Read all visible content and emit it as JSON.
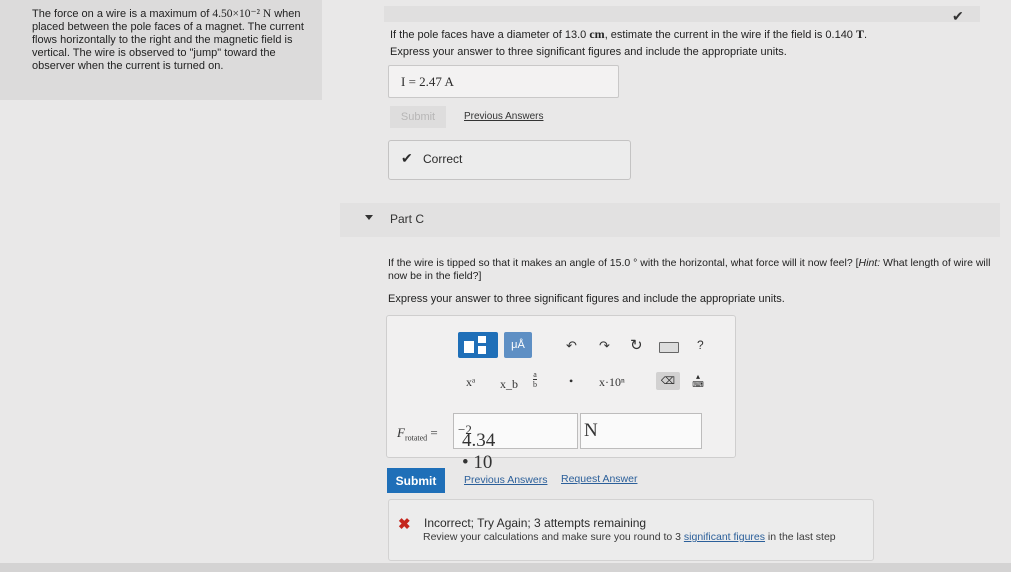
{
  "problem": {
    "line1_pre": "The force on a wire is a maximum of ",
    "force_value": "4.50×10⁻² N",
    "rest": "when placed between the pole faces of a magnet. The current flows horizontally to the right and the magnetic field is vertical. The wire is observed to \"jump\" toward the observer when the current is turned on."
  },
  "part_b": {
    "question_pre": "If the pole faces have a diameter of 13.0 ",
    "question_unit1": "cm",
    "question_mid": ", estimate the current in the wire if the field is 0.140 ",
    "question_unit2": "T",
    "question_end": ".",
    "instructions": "Express your answer to three significant figures and include the appropriate units.",
    "answer": "I = 2.47 A",
    "submit_label": "Submit",
    "previous_answers_label": "Previous Answers",
    "correct_label": "Correct"
  },
  "part_c": {
    "title": "Part C",
    "question_pre": "If the wire is tipped so that it makes an angle of 15.0 ° with the horizontal, what force will it now feel? [",
    "hint_label": "Hint:",
    "question_post": " What length of wire will now be in the field?]",
    "instructions": "Express your answer to three significant figures and include the appropriate units.",
    "toolbar": {
      "unit_button": "μÅ",
      "help": "?",
      "x_pow": "xᵃ",
      "x_sub": "x_b",
      "frac_top": "a",
      "frac_bottom": "b",
      "dot": "•",
      "sci": "x·10ⁿ",
      "backspace": "⌫"
    },
    "label": "F",
    "label_sub": "rotated",
    "equals": " =",
    "value_mantissa": "4.34 • 10",
    "value_exponent": "−2",
    "unit": "N",
    "submit_label": "Submit",
    "previous_answers_label": "Previous Answers",
    "request_answer_label": "Request Answer",
    "feedback_title": "Incorrect; Try Again; 3 attempts remaining",
    "feedback_pre": "Review your calculations and make sure you round to 3 ",
    "feedback_link": "significant figures",
    "feedback_post": " in the last step"
  },
  "colors": {
    "primary": "#1f6fb8",
    "error": "#c4261d"
  }
}
